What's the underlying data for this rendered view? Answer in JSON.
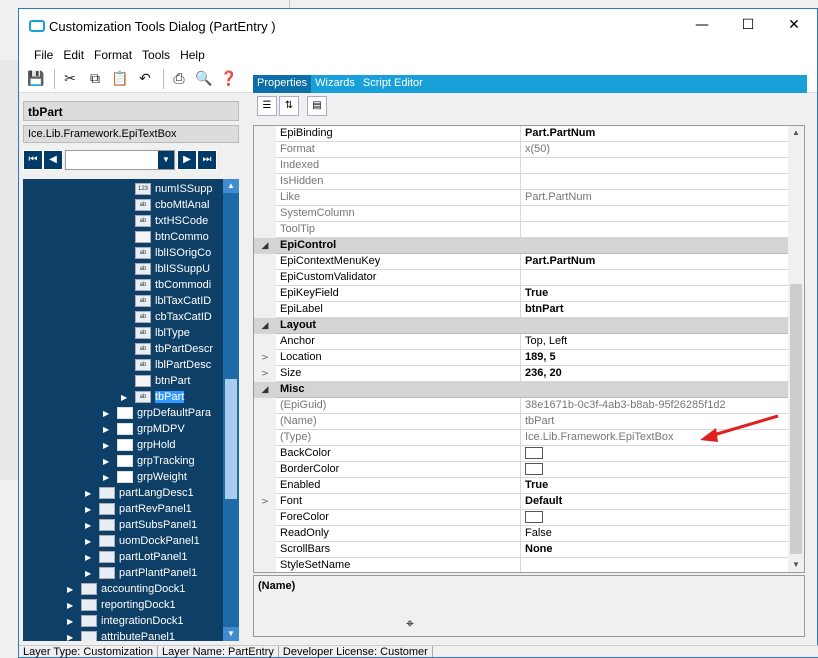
{
  "window": {
    "title": "Customization Tools Dialog  (PartEntry )"
  },
  "menu": [
    "File",
    "Edit",
    "Format",
    "Tools",
    "Help"
  ],
  "toolbar": [
    "save-icon",
    "cut-icon",
    "copy-icon",
    "paste-icon",
    "undo-icon",
    "print-icon",
    "print-preview-icon",
    "help-icon"
  ],
  "left": {
    "selected_control": "tbPart",
    "control_type": "Ice.Lib.Framework.EpiTextBox",
    "tree": [
      {
        "label": "numISSupp",
        "depth": 3,
        "icon": "123"
      },
      {
        "label": "cboMtlAnal",
        "depth": 3,
        "icon": "cb"
      },
      {
        "label": "txtHSCode",
        "depth": 3,
        "icon": "ab"
      },
      {
        "label": "btnCommo",
        "depth": 3,
        "icon": "btn"
      },
      {
        "label": "lblISOrigCo",
        "depth": 3,
        "icon": "ab"
      },
      {
        "label": "lblISSuppU",
        "depth": 3,
        "icon": "ab"
      },
      {
        "label": "tbCommodi",
        "depth": 3,
        "icon": "ab"
      },
      {
        "label": "lblTaxCatID",
        "depth": 3,
        "icon": "ab"
      },
      {
        "label": "cbTaxCatID",
        "depth": 3,
        "icon": "cb"
      },
      {
        "label": "lblType",
        "depth": 3,
        "icon": "ab"
      },
      {
        "label": "tbPartDescr",
        "depth": 3,
        "icon": "ab"
      },
      {
        "label": "lblPartDesc",
        "depth": 3,
        "icon": "ab"
      },
      {
        "label": "btnPart",
        "depth": 3,
        "icon": "btn"
      },
      {
        "label": "tbPart",
        "depth": 3,
        "icon": "ab",
        "selected": true,
        "expander": true
      },
      {
        "label": "grpDefaultPara",
        "depth": 2,
        "icon": "folder",
        "expander": true
      },
      {
        "label": "grpMDPV",
        "depth": 2,
        "icon": "folder",
        "expander": true
      },
      {
        "label": "grpHold",
        "depth": 2,
        "icon": "folder",
        "expander": true
      },
      {
        "label": "grpTracking",
        "depth": 2,
        "icon": "folder",
        "expander": true
      },
      {
        "label": "grpWeight",
        "depth": 2,
        "icon": "folder",
        "expander": true
      },
      {
        "label": "partLangDesc1",
        "depth": 1,
        "icon": "panel",
        "expander": true
      },
      {
        "label": "partRevPanel1",
        "depth": 1,
        "icon": "panel",
        "expander": true
      },
      {
        "label": "partSubsPanel1",
        "depth": 1,
        "icon": "panel",
        "expander": true
      },
      {
        "label": "uomDockPanel1",
        "depth": 1,
        "icon": "panel",
        "expander": true
      },
      {
        "label": "partLotPanel1",
        "depth": 1,
        "icon": "panel",
        "expander": true
      },
      {
        "label": "partPlantPanel1",
        "depth": 1,
        "icon": "panel",
        "expander": true
      },
      {
        "label": "accountingDock1",
        "depth": 0,
        "icon": "panel",
        "expander": true
      },
      {
        "label": "reportingDock1",
        "depth": 0,
        "icon": "panel",
        "expander": true
      },
      {
        "label": "integrationDock1",
        "depth": 0,
        "icon": "panel",
        "expander": true
      },
      {
        "label": "attributePanel1",
        "depth": 0,
        "icon": "panel",
        "expander": true
      }
    ]
  },
  "tabs": [
    "Properties",
    "Wizards",
    "Script Editor"
  ],
  "properties": [
    {
      "name": "EpiBinding",
      "value": "Part.PartNum",
      "bold": true
    },
    {
      "name": "Format",
      "value": "x(50)",
      "gray": true,
      "grayname": true
    },
    {
      "name": "Indexed",
      "value": "",
      "grayname": true
    },
    {
      "name": "IsHidden",
      "value": "",
      "grayname": true
    },
    {
      "name": "Like",
      "value": "Part.PartNum",
      "gray": true,
      "grayname": true
    },
    {
      "name": "SystemColumn",
      "value": "",
      "grayname": true
    },
    {
      "name": "ToolTip",
      "value": "",
      "grayname": true
    },
    {
      "name": "EpiControl",
      "category": true
    },
    {
      "name": "EpiContextMenuKey",
      "value": "Part.PartNum",
      "bold": true
    },
    {
      "name": "EpiCustomValidator",
      "value": ""
    },
    {
      "name": "EpiKeyField",
      "value": "True",
      "bold": true
    },
    {
      "name": "EpiLabel",
      "value": "btnPart",
      "bold": true
    },
    {
      "name": "Layout",
      "category": true
    },
    {
      "name": "Anchor",
      "value": "Top, Left"
    },
    {
      "name": "Location",
      "value": "189, 5",
      "bold": true,
      "expander": true
    },
    {
      "name": "Size",
      "value": "236, 20",
      "bold": true,
      "expander": true
    },
    {
      "name": "Misc",
      "category": true
    },
    {
      "name": "(EpiGuid)",
      "value": "38e1671b-0c3f-4ab3-b8ab-95f26285f1d2",
      "gray": true,
      "grayname": true
    },
    {
      "name": "(Name)",
      "value": "tbPart",
      "gray": true,
      "grayname": true
    },
    {
      "name": "(Type)",
      "value": "Ice.Lib.Framework.EpiTextBox",
      "gray": true,
      "grayname": true
    },
    {
      "name": "BackColor",
      "value": "",
      "swatch": true
    },
    {
      "name": "BorderColor",
      "value": "",
      "swatch": true
    },
    {
      "name": "Enabled",
      "value": "True",
      "bold": true
    },
    {
      "name": "Font",
      "value": "Default",
      "bold": true,
      "expander": true
    },
    {
      "name": "ForeColor",
      "value": "",
      "swatch": true
    },
    {
      "name": "ReadOnly",
      "value": "False"
    },
    {
      "name": "ScrollBars",
      "value": "None",
      "bold": true
    },
    {
      "name": "StyleSetName",
      "value": ""
    }
  ],
  "description": {
    "title": "(Name)"
  },
  "status": {
    "layer_type": "Layer Type:  Customization",
    "layer_name": "Layer Name:  PartEntry",
    "license": "Developer License:  Customer"
  },
  "colors": {
    "tree_bg": "#0e3f66",
    "tab_bar": "#1aa0d8",
    "accent_arrow": "#e0201e"
  }
}
